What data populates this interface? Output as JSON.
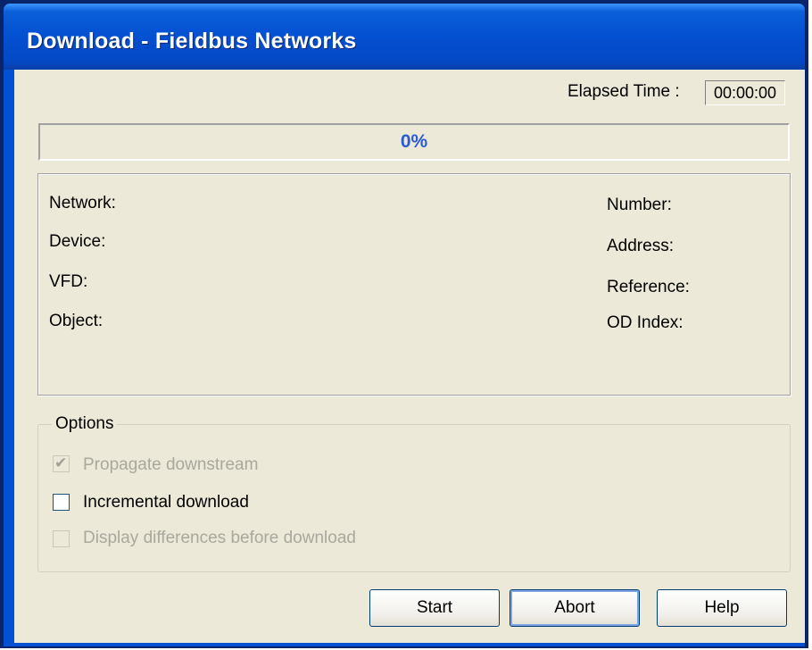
{
  "window": {
    "title": "Download - Fieldbus Networks"
  },
  "elapsed": {
    "label": "Elapsed Time :",
    "value": "00:00:00"
  },
  "progress": {
    "text": "0%",
    "fraction": 0
  },
  "info": {
    "left_labels": [
      "Network:",
      "Device:",
      "VFD:",
      "Object:"
    ],
    "right_labels": [
      "Number:",
      "Address:",
      "Reference:",
      "OD Index:"
    ]
  },
  "options": {
    "legend": "Options",
    "items": [
      {
        "label": "Propagate downstream",
        "checked": true,
        "enabled": false
      },
      {
        "label": "Incremental download",
        "checked": false,
        "enabled": true
      },
      {
        "label": "Display differences before download",
        "checked": false,
        "enabled": false
      }
    ]
  },
  "buttons": {
    "start": "Start",
    "abort": "Abort",
    "help": "Help"
  }
}
